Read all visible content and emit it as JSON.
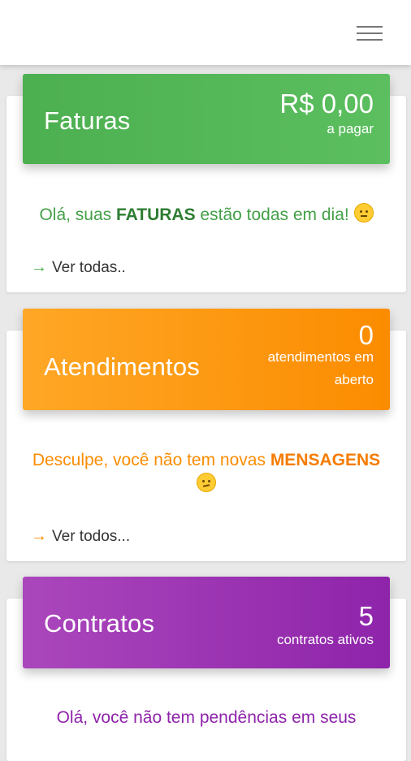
{
  "colors": {
    "green": "#4caf50",
    "green_text": "#2e7d32",
    "orange": "#fb8c00",
    "purple": "#8e24aa"
  },
  "topbar": {
    "menu_icon": "hamburger-menu-icon"
  },
  "faturas": {
    "title": "Faturas",
    "amount": "R$ 0,00",
    "amount_caption": "a pagar",
    "msg_prefix": "Olá, suas ",
    "msg_highlight": "FATURAS",
    "msg_suffix": " estão todas em dia!",
    "emoji": "wink-emoji",
    "link_label": "Ver todas.."
  },
  "atendimentos": {
    "title": "Atendimentos",
    "count": "0",
    "count_caption": "atendimentos em aberto",
    "msg_prefix": "Desculpe, você não tem novas ",
    "msg_highlight": "MENSAGENS",
    "emoji": "confused-emoji",
    "link_label": "Ver todos..."
  },
  "contratos": {
    "title": "Contratos",
    "count": "5",
    "count_caption": "contratos ativos",
    "msg_partial": "Olá, você não tem pendências em seus"
  }
}
